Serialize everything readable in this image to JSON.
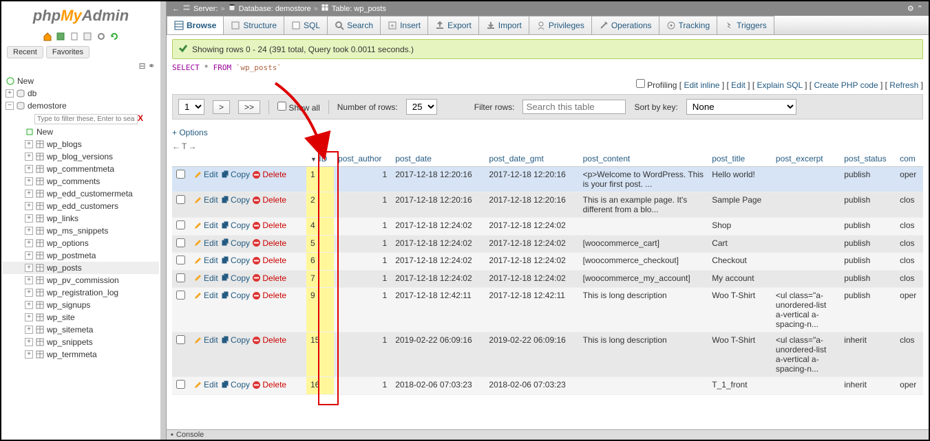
{
  "logo": {
    "php": "php",
    "my": "My",
    "admin": "Admin"
  },
  "sidebar_tabs": {
    "recent": "Recent",
    "favorites": "Favorites"
  },
  "tree": {
    "new": "New",
    "db": "db",
    "demostore": "demostore",
    "filter_placeholder": "Type to filter these, Enter to search",
    "filter_x": "X",
    "new2": "New",
    "tables": [
      "wp_blogs",
      "wp_blog_versions",
      "wp_commentmeta",
      "wp_comments",
      "wp_edd_customermeta",
      "wp_edd_customers",
      "wp_links",
      "wp_ms_snippets",
      "wp_options",
      "wp_postmeta",
      "wp_posts",
      "wp_pv_commission",
      "wp_registration_log",
      "wp_signups",
      "wp_site",
      "wp_sitemeta",
      "wp_snippets",
      "wp_termmeta"
    ]
  },
  "breadcrumb": {
    "server_lbl": "Server:",
    "server_val": "",
    "db_lbl": "Database:",
    "db_val": "demostore",
    "tbl_lbl": "Table:",
    "tbl_val": "wp_posts"
  },
  "tabs": {
    "browse": "Browse",
    "structure": "Structure",
    "sql": "SQL",
    "search": "Search",
    "insert": "Insert",
    "export": "Export",
    "import": "Import",
    "privileges": "Privileges",
    "operations": "Operations",
    "tracking": "Tracking",
    "triggers": "Triggers"
  },
  "msg": "Showing rows 0 - 24 (391 total, Query took 0.0011 seconds.)",
  "sql": {
    "select": "SELECT",
    "star": "*",
    "from": "FROM",
    "tbl": "`wp_posts`"
  },
  "actions": {
    "profiling": "Profiling",
    "editinline": "Edit inline",
    "edit": "Edit",
    "explain": "Explain SQL",
    "create": "Create PHP code",
    "refresh": "Refresh"
  },
  "nav": {
    "page": "1",
    "next": ">",
    "last": ">>",
    "showall": "Show all",
    "numrows_lbl": "Number of rows:",
    "numrows": "25",
    "filter_lbl": "Filter rows:",
    "filter_ph": "Search this table",
    "sort_lbl": "Sort by key:",
    "sort_val": "None"
  },
  "options": "+ Options",
  "colctrl": "←T→",
  "headers": {
    "id": "ID",
    "post_author": "post_author",
    "post_date": "post_date",
    "post_date_gmt": "post_date_gmt",
    "post_content": "post_content",
    "post_title": "post_title",
    "post_excerpt": "post_excerpt",
    "post_status": "post_status",
    "com": "com"
  },
  "row_actions": {
    "edit": "Edit",
    "copy": "Copy",
    "delete": "Delete"
  },
  "rows": [
    {
      "id": "1",
      "author": "1",
      "date": "2017-12-18 12:20:16",
      "gmt": "2017-12-18 12:20:16",
      "content": "<p>Welcome to WordPress. This is your first post. ...",
      "title": "Hello world!",
      "excerpt": "",
      "status": "publish",
      "com": "oper"
    },
    {
      "id": "2",
      "author": "1",
      "date": "2017-12-18 12:20:16",
      "gmt": "2017-12-18 12:20:16",
      "content": "This is an example page. It's different from a blo...",
      "title": "Sample Page",
      "excerpt": "",
      "status": "publish",
      "com": "clos"
    },
    {
      "id": "4",
      "author": "1",
      "date": "2017-12-18 12:24:02",
      "gmt": "2017-12-18 12:24:02",
      "content": "",
      "title": "Shop",
      "excerpt": "",
      "status": "publish",
      "com": "clos"
    },
    {
      "id": "5",
      "author": "1",
      "date": "2017-12-18 12:24:02",
      "gmt": "2017-12-18 12:24:02",
      "content": "[woocommerce_cart]",
      "title": "Cart",
      "excerpt": "",
      "status": "publish",
      "com": "clos"
    },
    {
      "id": "6",
      "author": "1",
      "date": "2017-12-18 12:24:02",
      "gmt": "2017-12-18 12:24:02",
      "content": "[woocommerce_checkout]",
      "title": "Checkout",
      "excerpt": "",
      "status": "publish",
      "com": "clos"
    },
    {
      "id": "7",
      "author": "1",
      "date": "2017-12-18 12:24:02",
      "gmt": "2017-12-18 12:24:02",
      "content": "[woocommerce_my_account]",
      "title": "My account",
      "excerpt": "",
      "status": "publish",
      "com": "clos"
    },
    {
      "id": "9",
      "author": "1",
      "date": "2017-12-18 12:42:11",
      "gmt": "2017-12-18 12:42:11",
      "content": "This is long description",
      "title": "Woo T-Shirt",
      "excerpt": "<ul class=\"a-unordered-list a-vertical a-spacing-n...",
      "status": "publish",
      "com": "oper"
    },
    {
      "id": "15",
      "author": "1",
      "date": "2019-02-22 06:09:16",
      "gmt": "2019-02-22 06:09:16",
      "content": "This is long description",
      "title": "Woo T-Shirt",
      "excerpt": "<ul class=\"a-unordered-list a-vertical a-spacing-n...",
      "status": "inherit",
      "com": "clos"
    },
    {
      "id": "16",
      "author": "1",
      "date": "2018-02-06 07:03:23",
      "gmt": "2018-02-06 07:03:23",
      "content": "",
      "title": "T_1_front",
      "excerpt": "",
      "status": "inherit",
      "com": "oper"
    }
  ],
  "console": "Console"
}
